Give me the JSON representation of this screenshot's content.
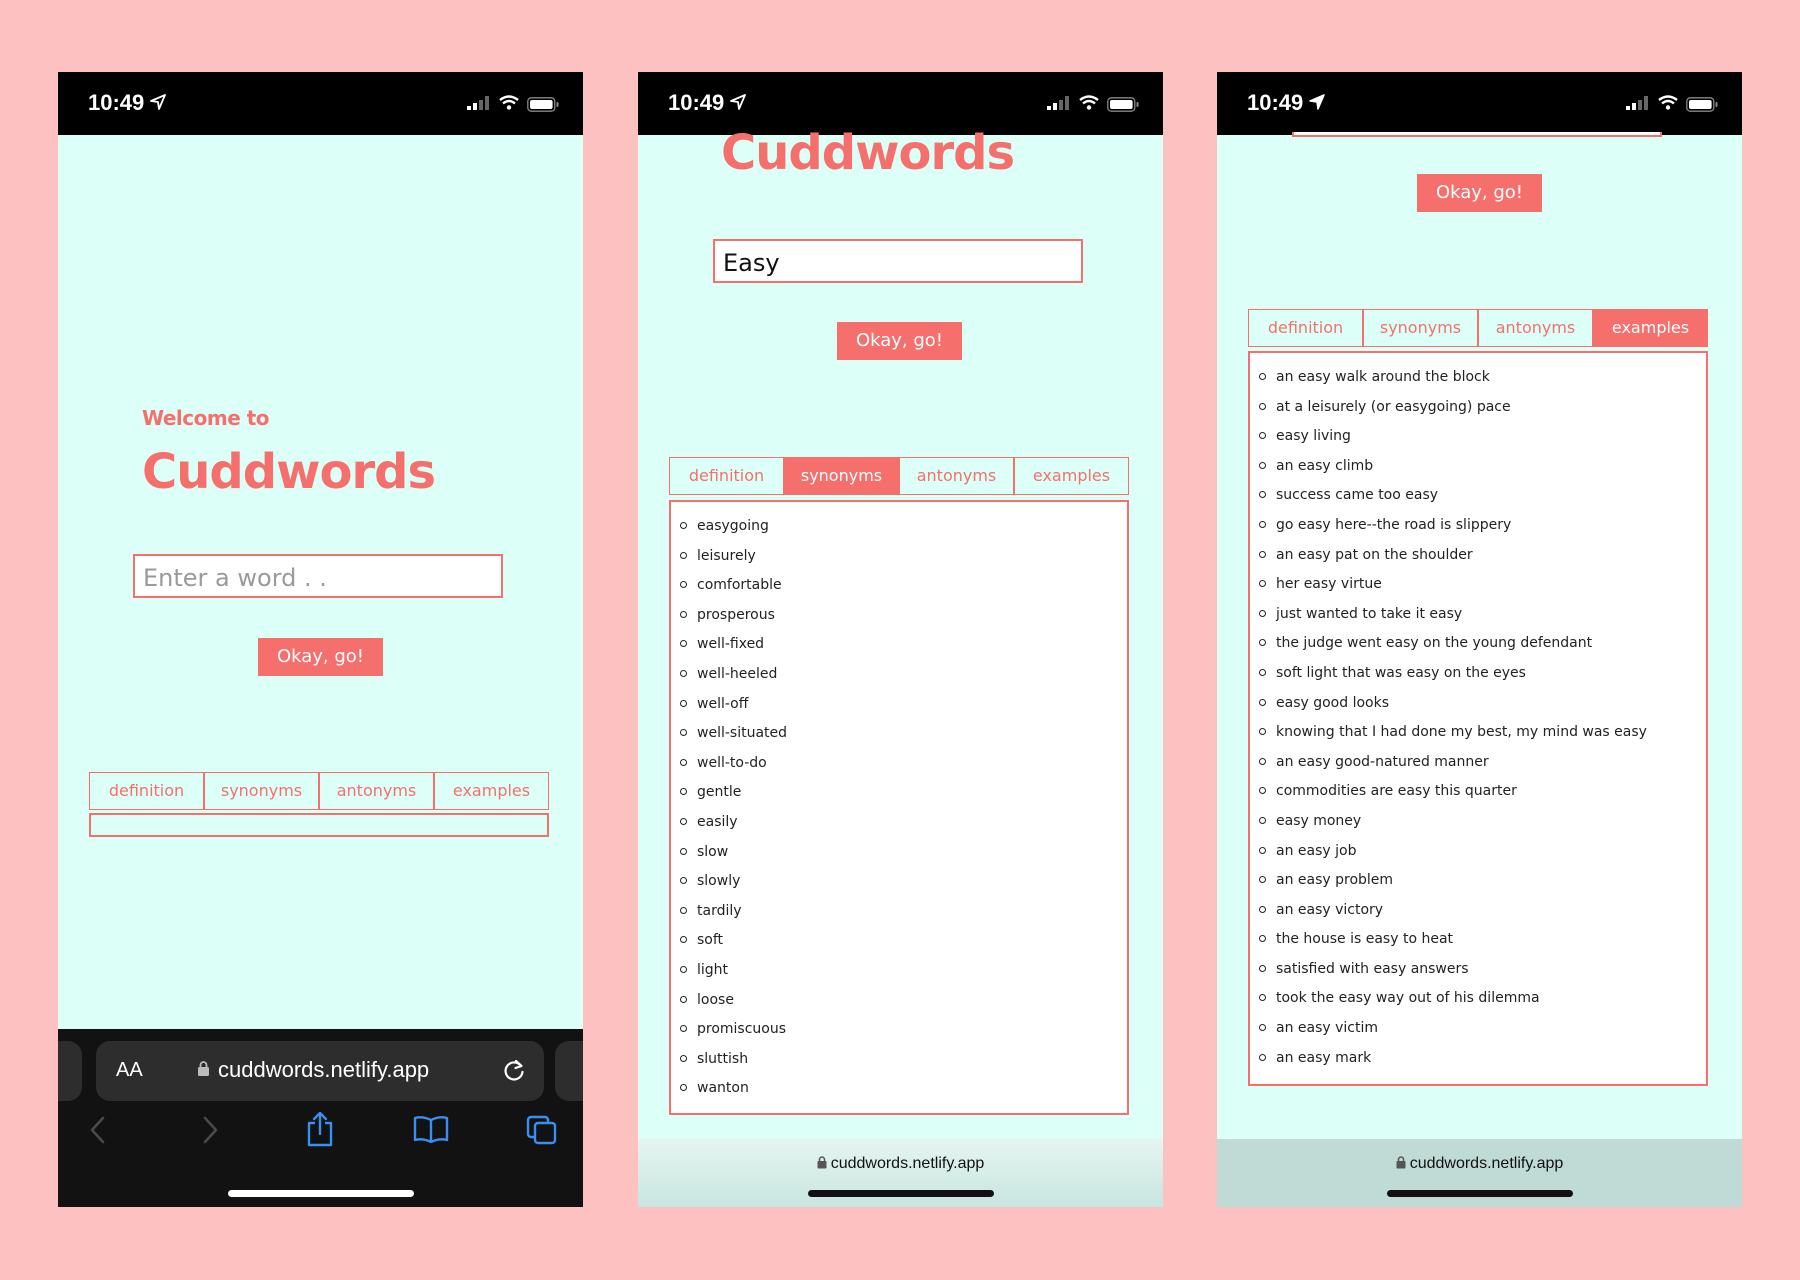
{
  "status_bar": {
    "time": "10:49"
  },
  "brand": {
    "welcome": "Welcome to",
    "name": "Cuddwords"
  },
  "search": {
    "placeholder": "Enter a word . .",
    "query": "Easy",
    "button_label": "Okay, go!"
  },
  "tabs": [
    "definition",
    "synonyms",
    "antonyms",
    "examples"
  ],
  "browser": {
    "url": "cuddwords.netlify.app",
    "text_size_label": "AA"
  },
  "phones": {
    "phone1": {
      "active_tab": null
    },
    "phone2": {
      "active_tab": "synonyms"
    },
    "phone3": {
      "active_tab": "examples"
    }
  },
  "synonyms": [
    "easygoing",
    "leisurely",
    "comfortable",
    "prosperous",
    "well-fixed",
    "well-heeled",
    "well-off",
    "well-situated",
    "well-to-do",
    "gentle",
    "easily",
    "slow",
    "slowly",
    "tardily",
    "soft",
    "light",
    "loose",
    "promiscuous",
    "sluttish",
    "wanton"
  ],
  "examples": [
    "an easy walk around the block",
    "at a leisurely (or easygoing) pace",
    "easy living",
    "an easy climb",
    "success came too easy",
    "go easy here--the road is slippery",
    "an easy pat on the shoulder",
    "her easy virtue",
    "just wanted to take it easy",
    "the judge went easy on the young defendant",
    "soft light that was easy on the eyes",
    "easy good looks",
    "knowing that I had done my best, my mind was easy",
    "an easy good-natured manner",
    "commodities are easy this quarter",
    "easy money",
    "an easy job",
    "an easy problem",
    "an easy victory",
    "the house is easy to heat",
    "satisfied with easy answers",
    "took the easy way out of his dilemma",
    "an easy victim",
    "an easy mark"
  ],
  "colors": {
    "background": "#fdc1c1",
    "app_bg": "#dcfff7",
    "accent": "#f5706d"
  }
}
